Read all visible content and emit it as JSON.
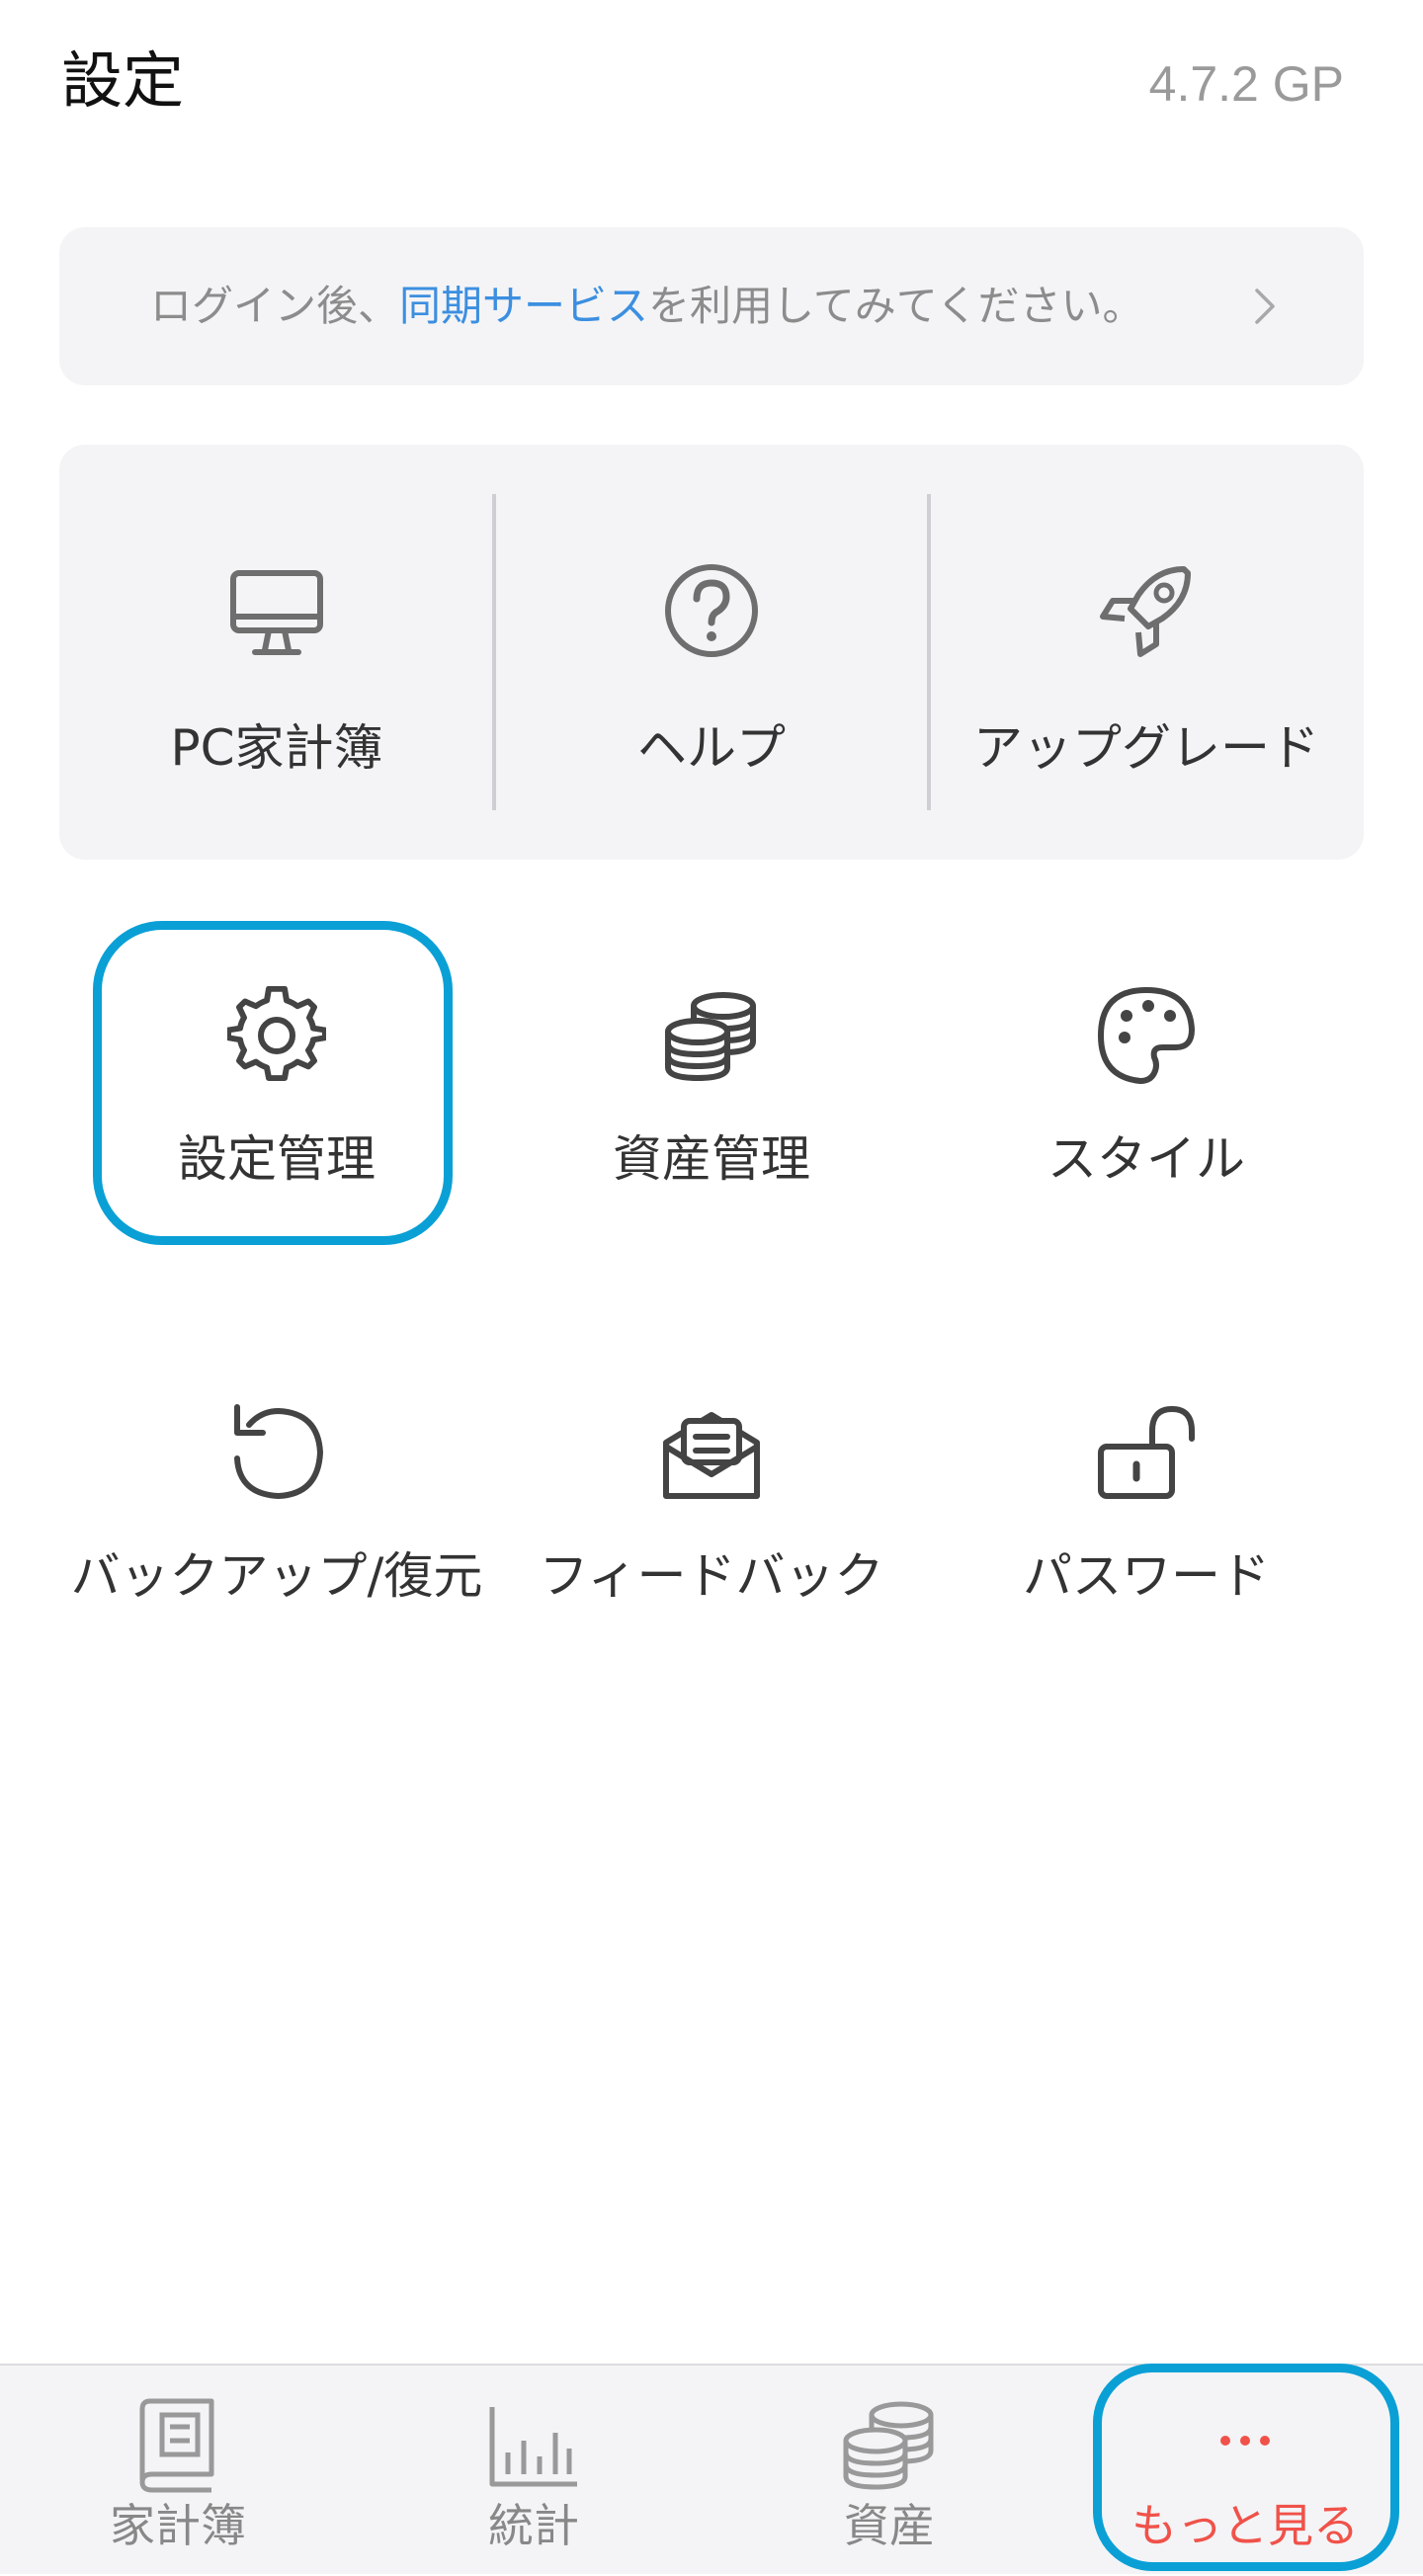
{
  "header": {
    "title": "設定",
    "version": "4.7.2 GP"
  },
  "login_banner": {
    "prefix": "ログイン後、",
    "link": "同期サービス",
    "suffix": "を利用してみてください。"
  },
  "quick_actions": [
    {
      "label": "PC家計簿",
      "icon": "monitor-icon"
    },
    {
      "label": "ヘルプ",
      "icon": "help-circle-icon"
    },
    {
      "label": "アップグレード",
      "icon": "rocket-icon"
    }
  ],
  "menu_grid": [
    {
      "label": "設定管理",
      "icon": "gear-icon",
      "highlighted": true
    },
    {
      "label": "資産管理",
      "icon": "coins-icon"
    },
    {
      "label": "スタイル",
      "icon": "palette-icon"
    },
    {
      "label": "バックアップ/復元",
      "icon": "restore-icon"
    },
    {
      "label": "フィードバック",
      "icon": "open-envelope-icon"
    },
    {
      "label": "パスワード",
      "icon": "unlock-icon"
    }
  ],
  "tabbar": {
    "tabs": [
      {
        "label": "家計簿",
        "icon": "book-icon"
      },
      {
        "label": "統計",
        "icon": "bar-chart-icon"
      },
      {
        "label": "資産",
        "icon": "coins-icon"
      },
      {
        "label": "もっと見る",
        "icon": "more-dots-icon",
        "active": true
      }
    ]
  },
  "colors": {
    "accent_link": "#3c8fe0",
    "active_tab": "#f0524a",
    "highlight_outline": "#0aa0d6",
    "card_background": "#f4f4f6"
  }
}
